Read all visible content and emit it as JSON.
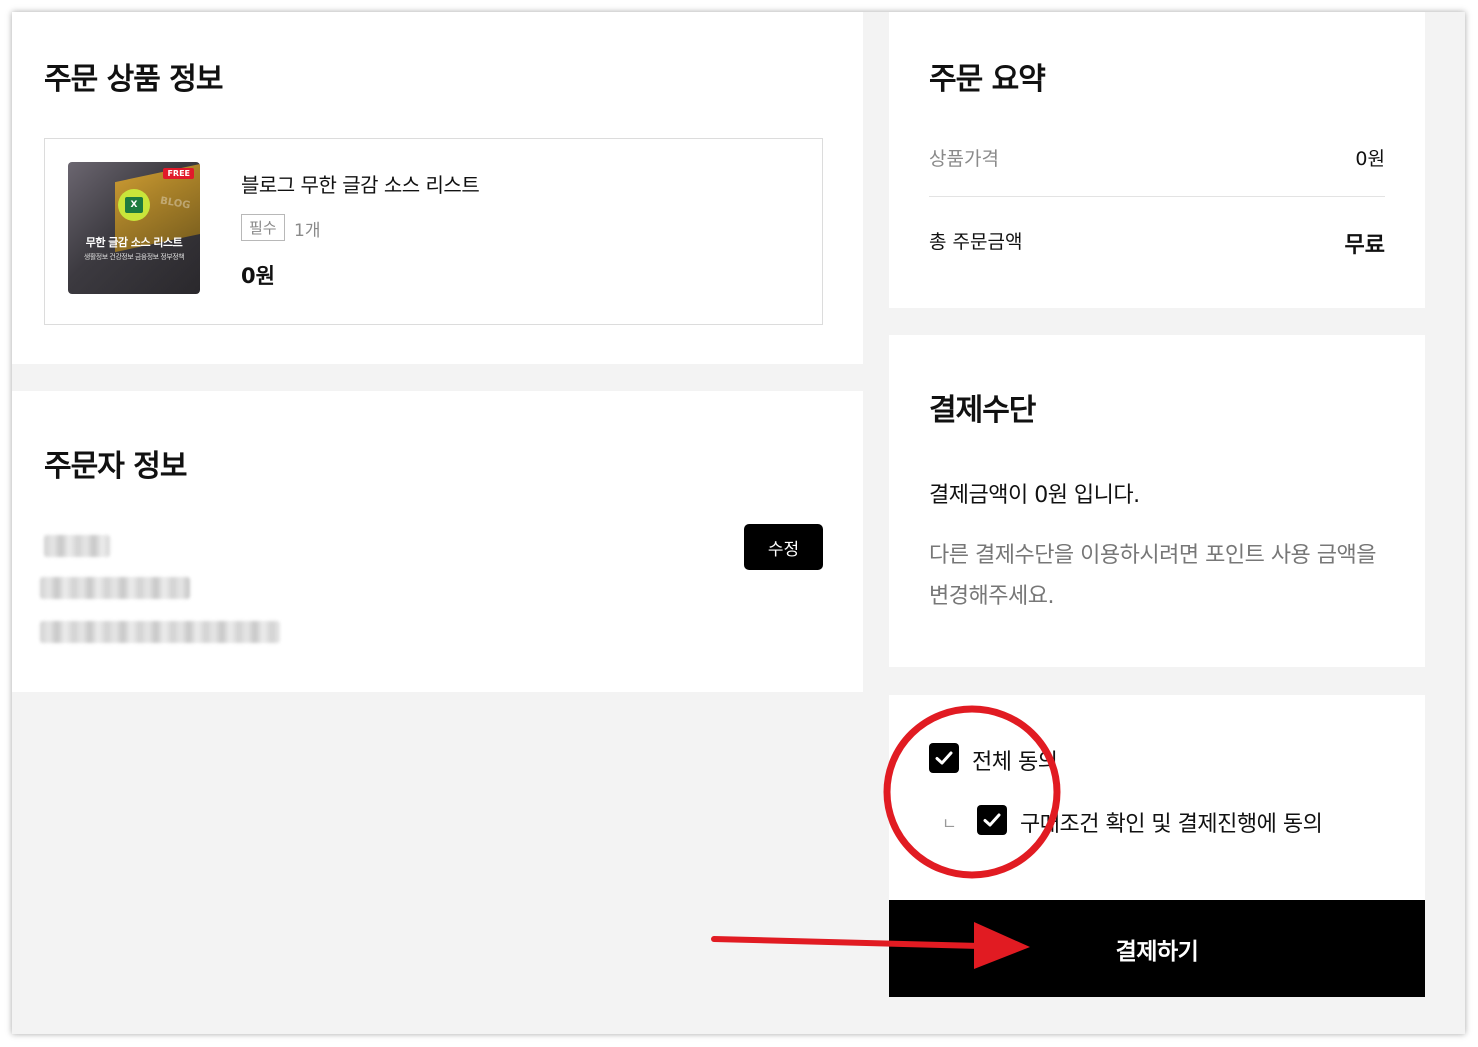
{
  "product_section": {
    "title": "주문 상품 정보",
    "product": {
      "thumbnail_badge": "FREE",
      "thumbnail_title": "무한 글감 소스 리스트",
      "thumbnail_subtitle": "생활정보 건강정보 금융정보 정부정책",
      "name": "블로그 무한 글감 소스 리스트",
      "required_badge": "필수",
      "quantity": "1개",
      "price": "0원"
    }
  },
  "orderer_section": {
    "title": "주문자 정보",
    "edit_label": "수정"
  },
  "summary_section": {
    "title": "주문 요약",
    "product_price_label": "상품가격",
    "product_price_value": "0원",
    "total_label": "총 주문금액",
    "total_value": "무료"
  },
  "payment_section": {
    "title": "결제수단",
    "message": "결제금액이 0원 입니다.",
    "sub_message": "다른 결제수단을 이용하시려면 포인트 사용 금액을 변경해주세요."
  },
  "agreement": {
    "all_label": "전체 동의",
    "all_checked": true,
    "sub_mark": "ㄴ",
    "purchase_label": "구매조건 확인 및 결제진행에 동의",
    "purchase_checked": true
  },
  "pay_button_label": "결제하기",
  "colors": {
    "annotation_red": "#e11b22",
    "background": "#f3f3f3",
    "button": "#000000"
  }
}
